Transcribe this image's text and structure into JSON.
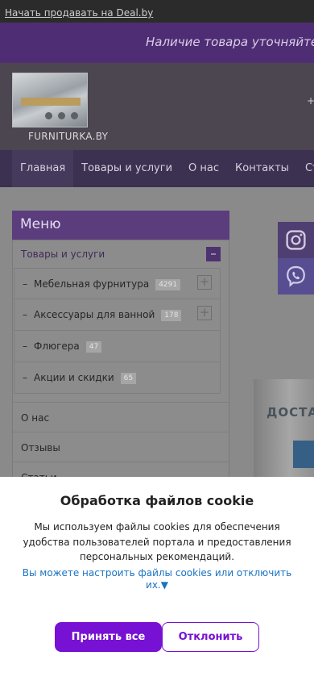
{
  "topbar": {
    "sell_link": "Начать продавать на Deal.by"
  },
  "notice": {
    "text": "Наличие товара уточняйте"
  },
  "header": {
    "brand": "FURNITURKA.BY",
    "phone_partial": "+"
  },
  "nav": {
    "items": [
      {
        "label": "Главная",
        "active": true
      },
      {
        "label": "Товары и услуги"
      },
      {
        "label": "О нас"
      },
      {
        "label": "Контакты"
      },
      {
        "label": "Стат"
      }
    ]
  },
  "menu": {
    "title": "Меню",
    "top_item": "Товары и услуги",
    "sub_items": [
      {
        "label": "Мебельная фурнитура",
        "count": "4291",
        "expand": "+"
      },
      {
        "label": "Аксессуары для ванной",
        "count": "178",
        "expand": "+"
      },
      {
        "label": "Флюгера",
        "count": "47"
      },
      {
        "label": "Акции и скидки",
        "count": "65"
      }
    ],
    "dash": "–",
    "collapse": "–",
    "level1": [
      "О нас",
      "Отзывы",
      "Статьи"
    ]
  },
  "banner": {
    "text": "ДОСТА"
  },
  "cookie": {
    "title": "Обработка файлов cookie",
    "body": "Мы используем файлы cookies для обеспечения удобства пользователей портала и предоставления персональных рекомендаций.",
    "settings_link": "Вы можете настроить файлы cookies или отключить их.▼",
    "accept": "Принять все",
    "decline": "Отклонить"
  },
  "colors": {
    "accent": "#7711d4",
    "nav_bg": "#3c3150",
    "menu_head": "#5b3d7e"
  },
  "icons": {
    "instagram": "instagram-icon",
    "viber": "viber-icon"
  }
}
